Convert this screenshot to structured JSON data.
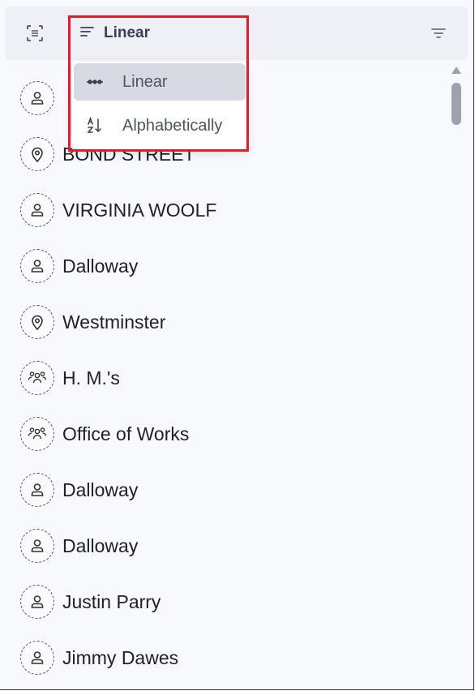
{
  "toolbar": {
    "left_icon": "scan-icon",
    "sort_icon": "sort-lines-icon",
    "sort_label": "Linear",
    "right_icon": "filter-icon"
  },
  "dropdown": {
    "options": [
      {
        "label": "Linear",
        "icon": "dots-line-icon",
        "selected": true
      },
      {
        "label": "Alphabetically",
        "icon": "sort-az-icon",
        "selected": false
      }
    ]
  },
  "entities": [
    {
      "name": "",
      "type": "person",
      "icon": "person-icon"
    },
    {
      "name": "BOND STREET",
      "type": "place",
      "icon": "location-pin-icon"
    },
    {
      "name": "VIRGINIA WOOLF",
      "type": "person",
      "icon": "person-icon"
    },
    {
      "name": "Dalloway",
      "type": "person",
      "icon": "person-icon"
    },
    {
      "name": "Westminster",
      "type": "place",
      "icon": "location-pin-icon"
    },
    {
      "name": "H. M.'s",
      "type": "organization",
      "icon": "group-icon"
    },
    {
      "name": "Office of Works",
      "type": "organization",
      "icon": "group-icon"
    },
    {
      "name": "Dalloway",
      "type": "person",
      "icon": "person-icon"
    },
    {
      "name": "Dalloway",
      "type": "person",
      "icon": "person-icon"
    },
    {
      "name": "Justin Parry",
      "type": "person",
      "icon": "person-icon"
    },
    {
      "name": "Jimmy Dawes",
      "type": "person",
      "icon": "person-icon"
    }
  ],
  "colors": {
    "highlight": "#e11d2b",
    "selected_option_bg": "#d7dae2",
    "background": "#f8f9fc"
  }
}
